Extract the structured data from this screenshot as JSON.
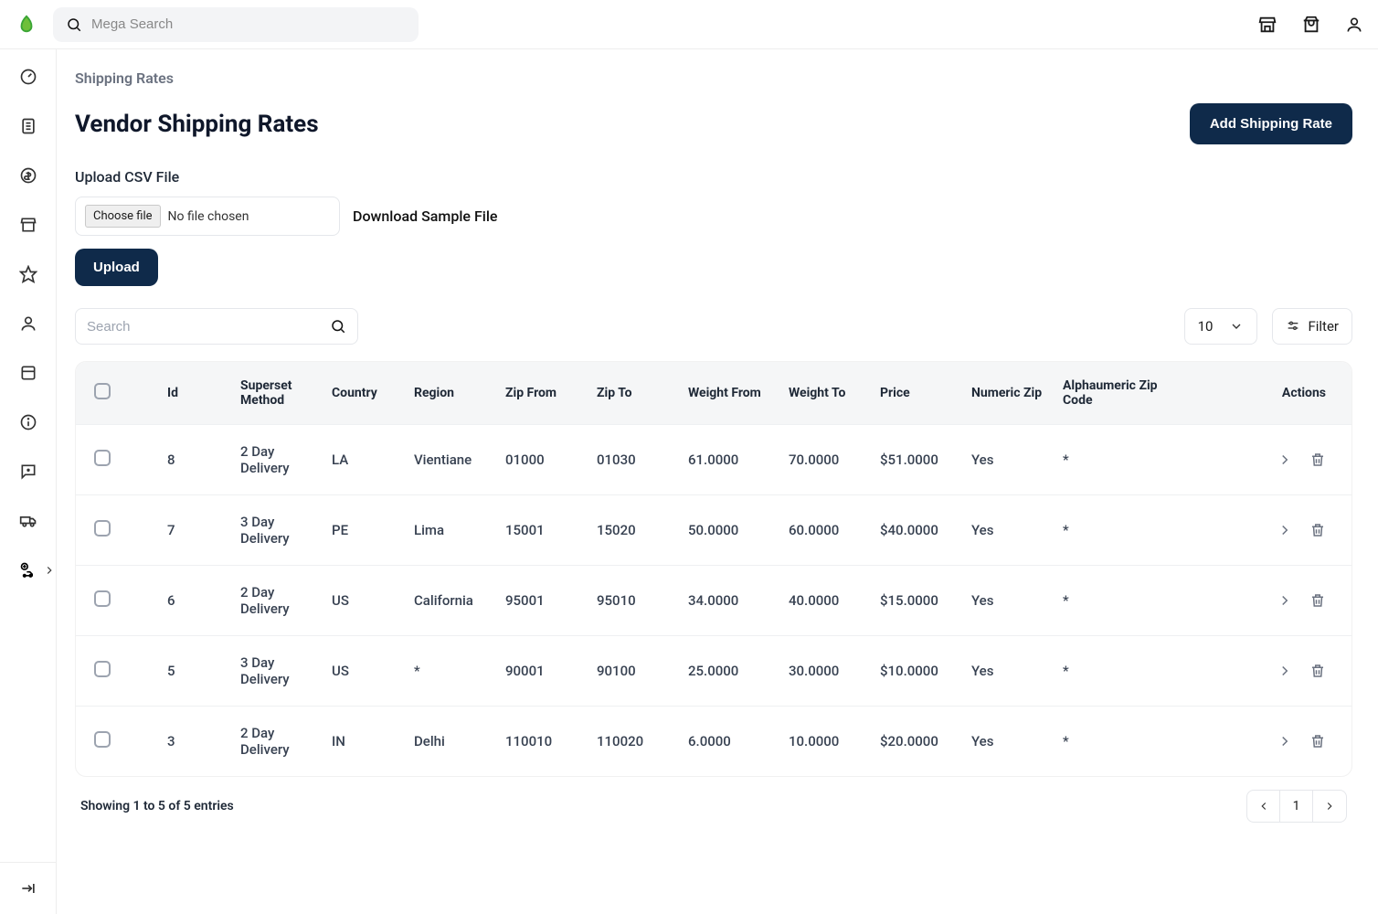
{
  "header": {
    "search_placeholder": "Mega Search"
  },
  "breadcrumb": "Shipping Rates",
  "page": {
    "title": "Vendor Shipping Rates",
    "add_button": "Add Shipping Rate"
  },
  "csv": {
    "label": "Upload CSV File",
    "choose_file": "Choose file",
    "no_file": "No file chosen",
    "download_sample": "Download Sample File",
    "upload": "Upload"
  },
  "search": {
    "placeholder": "Search",
    "page_size": "10",
    "filter_label": "Filter"
  },
  "columns": {
    "id": "Id",
    "method": "Superset Method",
    "country": "Country",
    "region": "Region",
    "zip_from": "Zip From",
    "zip_to": "Zip To",
    "weight_from": "Weight From",
    "weight_to": "Weight To",
    "price": "Price",
    "numeric_zip": "Numeric Zip",
    "alpha_zip": "Alphaumeric Zip Code",
    "actions": "Actions"
  },
  "rows": [
    {
      "id": "8",
      "method": "2 Day Delivery",
      "country": "LA",
      "region": "Vientiane",
      "zip_from": "01000",
      "zip_to": "01030",
      "weight_from": "61.0000",
      "weight_to": "70.0000",
      "price": "$51.0000",
      "numeric_zip": "Yes",
      "alpha_zip": "*"
    },
    {
      "id": "7",
      "method": "3 Day Delivery",
      "country": "PE",
      "region": "Lima",
      "zip_from": "15001",
      "zip_to": "15020",
      "weight_from": "50.0000",
      "weight_to": "60.0000",
      "price": "$40.0000",
      "numeric_zip": "Yes",
      "alpha_zip": "*"
    },
    {
      "id": "6",
      "method": "2 Day Delivery",
      "country": "US",
      "region": "California",
      "zip_from": "95001",
      "zip_to": "95010",
      "weight_from": "34.0000",
      "weight_to": "40.0000",
      "price": "$15.0000",
      "numeric_zip": "Yes",
      "alpha_zip": "*"
    },
    {
      "id": "5",
      "method": "3 Day Delivery",
      "country": "US",
      "region": "*",
      "zip_from": "90001",
      "zip_to": "90100",
      "weight_from": "25.0000",
      "weight_to": "30.0000",
      "price": "$10.0000",
      "numeric_zip": "Yes",
      "alpha_zip": "*"
    },
    {
      "id": "3",
      "method": "2 Day Delivery",
      "country": "IN",
      "region": "Delhi",
      "zip_from": "110010",
      "zip_to": "110020",
      "weight_from": "6.0000",
      "weight_to": "10.0000",
      "price": "$20.0000",
      "numeric_zip": "Yes",
      "alpha_zip": "*"
    }
  ],
  "footer": {
    "showing": "Showing 1 to 5 of 5 entries",
    "current_page": "1"
  }
}
